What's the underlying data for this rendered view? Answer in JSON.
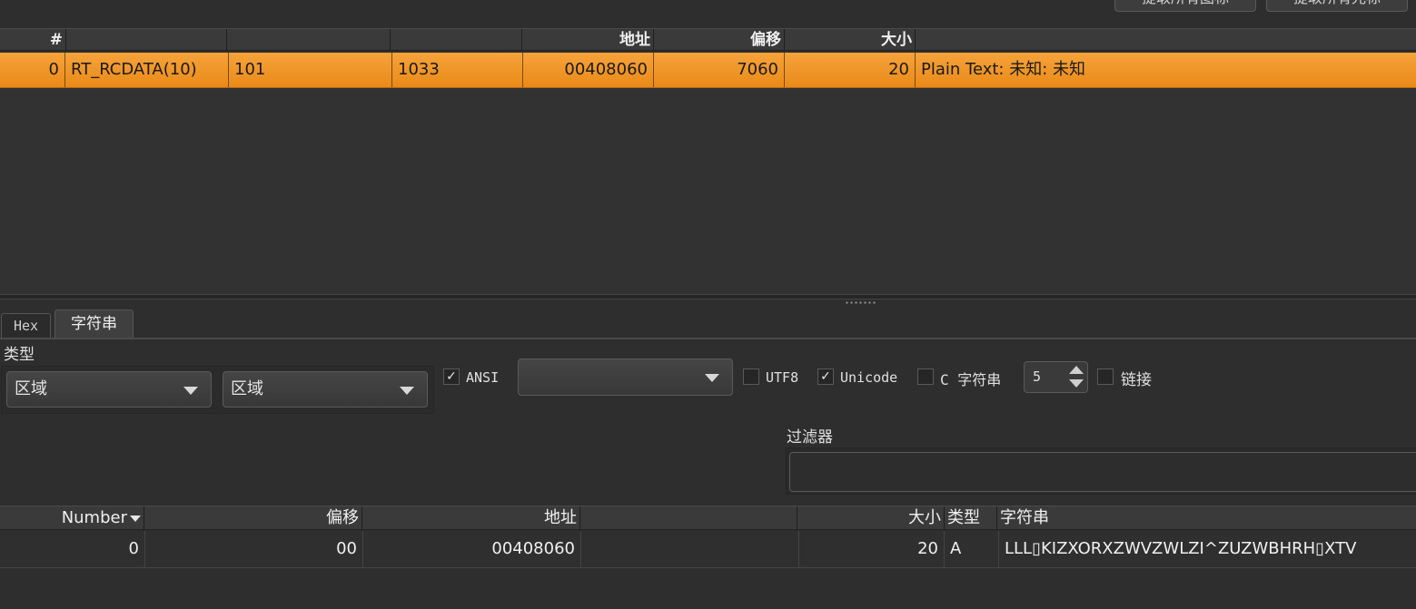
{
  "toolbar": {
    "extract_icons_label": "提取所有图标",
    "extract_cursors_label": "提取所有光标"
  },
  "resources": {
    "columns": [
      "#",
      "",
      "",
      "",
      "地址",
      "偏移",
      "大小",
      ""
    ],
    "rows": [
      {
        "index": "0",
        "type": "RT_RCDATA(10)",
        "name": "101",
        "language": "1033",
        "address": "00408060",
        "offset": "7060",
        "size": "20",
        "info": "Plain Text: 未知: 未知"
      }
    ]
  },
  "tabs": [
    {
      "label": "Hex",
      "active": false
    },
    {
      "label": "字符串",
      "active": true
    }
  ],
  "strings_panel": {
    "type_label": "类型",
    "region1_value": "区域",
    "region2_value": "区域",
    "ansi": {
      "label": "ANSI",
      "checked": true
    },
    "codepage_value": "",
    "utf8": {
      "label": "UTF8",
      "checked": false
    },
    "unicode": {
      "label": "Unicode",
      "checked": true
    },
    "cstring": {
      "label": "C 字符串",
      "checked": false
    },
    "min_length": "5",
    "link": {
      "label": "链接",
      "checked": false
    },
    "filter_label": "过滤器",
    "filter_value": ""
  },
  "strings_table": {
    "columns": {
      "number": "Number",
      "offset": "偏移",
      "address": "地址",
      "blank": "",
      "size": "大小",
      "type": "类型",
      "string": "字符串"
    },
    "rows": [
      {
        "number": "0",
        "offset": "00",
        "address": "00408060",
        "blank": "",
        "size": "20",
        "type": "A",
        "string": "LLL▯KIZXORXZWVZWLZI^ZUZWBHRH▯XTV"
      }
    ]
  },
  "colors": {
    "selection": "#f0952a",
    "background": "#2e2e2e",
    "header": "#3a3a3a"
  }
}
